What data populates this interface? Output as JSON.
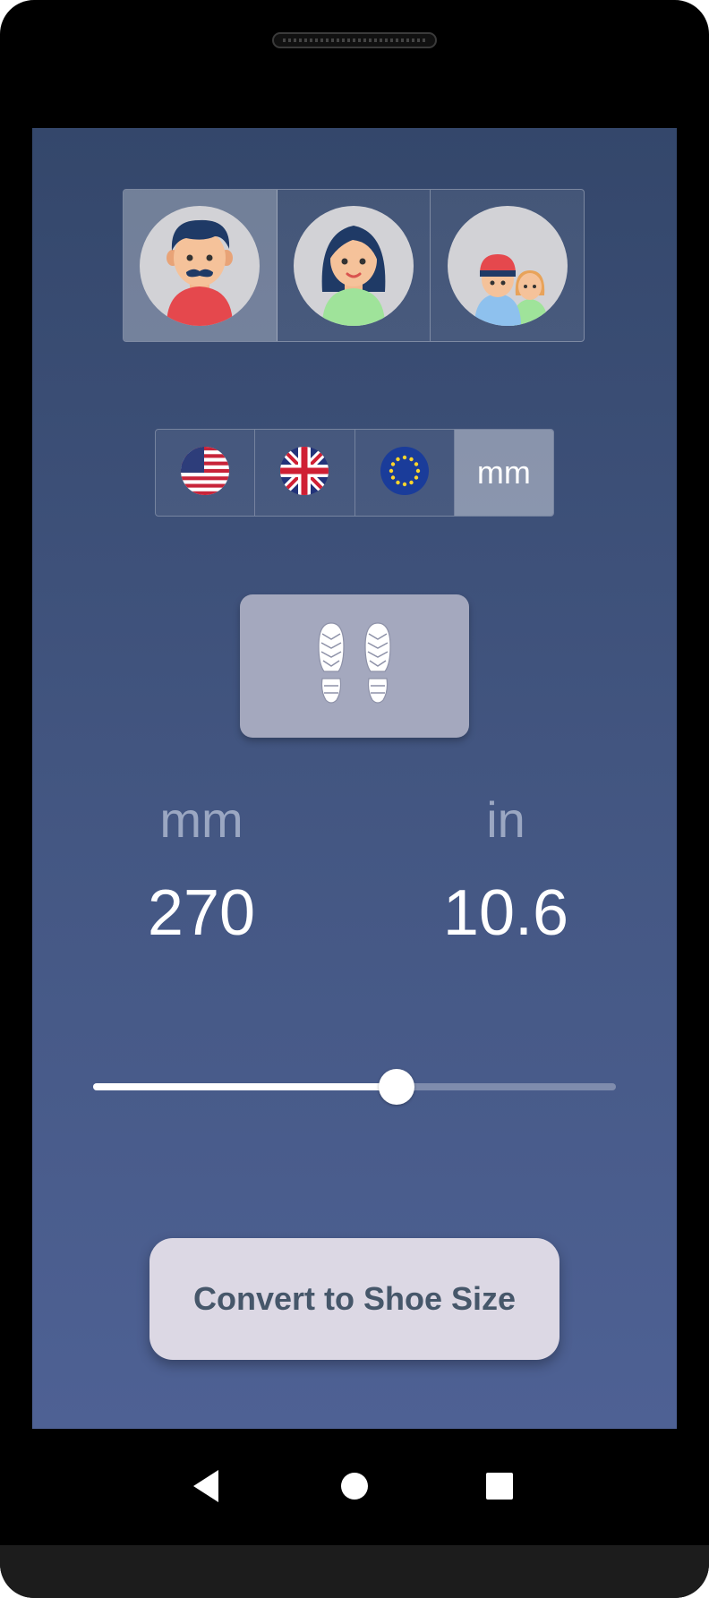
{
  "gender_selector": {
    "options": [
      {
        "name": "man",
        "selected": true
      },
      {
        "name": "woman",
        "selected": false
      },
      {
        "name": "kids",
        "selected": false
      }
    ]
  },
  "unit_selector": {
    "options": [
      {
        "name": "US",
        "icon": "us-flag-icon",
        "selected": false
      },
      {
        "name": "UK",
        "icon": "uk-flag-icon",
        "selected": false
      },
      {
        "name": "EU",
        "icon": "eu-flag-icon",
        "selected": false
      },
      {
        "name": "mm",
        "label": "mm",
        "selected": true
      }
    ]
  },
  "measurement": {
    "left_unit": "mm",
    "left_value": "270",
    "right_unit": "in",
    "right_value": "10.6"
  },
  "slider": {
    "value_fraction": 0.58
  },
  "convert_button": {
    "label": "Convert to Shoe Size"
  },
  "colors": {
    "background_top": "#34476b",
    "background_bottom": "#4e6194",
    "button_bg": "#dcd8e4",
    "button_text": "#46576a"
  }
}
